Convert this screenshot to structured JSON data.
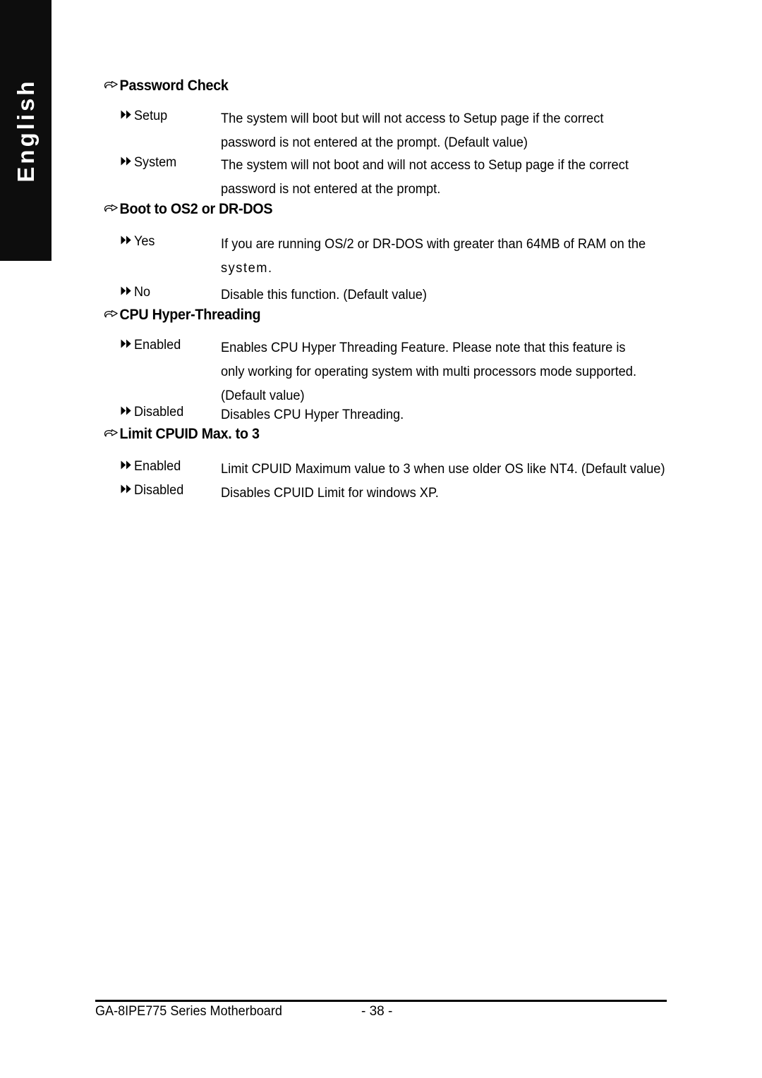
{
  "sidebar": {
    "language_tab": "English"
  },
  "icons": {
    "section_bullet": "pointing-hand-icon",
    "item_bullet": "double-triangle-right-icon"
  },
  "sections": [
    {
      "title": "Password Check",
      "items": [
        {
          "label": "Setup",
          "lines": [
            "The system will boot but will not access to Setup page if the correct",
            "password is not entered at the prompt. (Default value)"
          ]
        },
        {
          "label": "System",
          "lines": [
            "The system will not boot and will not access to Setup page if the correct",
            "password is not entered at the prompt."
          ]
        }
      ]
    },
    {
      "title": "Boot to OS2 or DR-DOS",
      "items": [
        {
          "label": "Yes",
          "lines": [
            "If you are running OS/2 or DR-DOS with greater than 64MB of RAM on the",
            "system."
          ]
        },
        {
          "label": "No",
          "lines": [
            "Disable this function. (Default value)"
          ]
        }
      ]
    },
    {
      "title": "CPU Hyper-Threading",
      "items": [
        {
          "label": "Enabled",
          "lines": [
            "Enables CPU Hyper Threading Feature. Please note that this feature is",
            "only working for operating system with multi processors mode supported.",
            "(Default value)"
          ]
        },
        {
          "label": "Disabled",
          "lines": [
            "Disables CPU Hyper Threading."
          ]
        }
      ]
    },
    {
      "title": "Limit CPUID Max. to 3",
      "items": [
        {
          "label": "Enabled",
          "lines": [
            "Limit CPUID Maximum value to 3 when use older OS like NT4. (Default value)"
          ]
        },
        {
          "label": "Disabled",
          "lines": [
            "Disables CPUID Limit for windows XP."
          ]
        }
      ]
    }
  ],
  "footer": {
    "product": "GA-8IPE775 Series Motherboard",
    "page_number": "- 38 -"
  },
  "colors": {
    "tab_background": "#0d0d0d",
    "tab_text": "#ffffff",
    "page_background": "#ffffff",
    "text": "#000000"
  }
}
